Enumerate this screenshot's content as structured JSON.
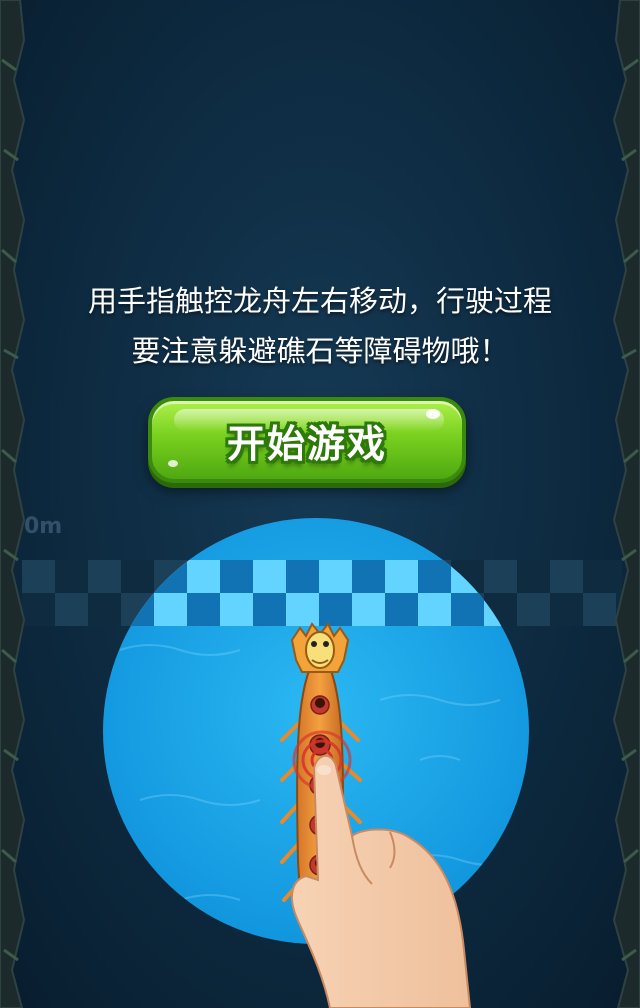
{
  "instructions": {
    "line1": "用手指触控龙舟左右移动，行驶过程",
    "line2": "要注意躲避礁石等障碍物哦！"
  },
  "start_button": {
    "label": "开始游戏"
  },
  "distance": {
    "value": "0m"
  },
  "colors": {
    "water": "#1aa6e8",
    "button_green": "#79d01f",
    "button_border": "#3a8a0d",
    "background": "#0d2a40"
  }
}
